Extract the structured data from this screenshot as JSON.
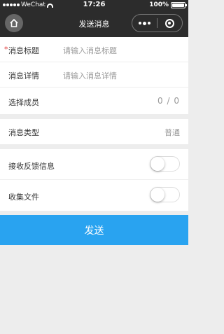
{
  "status_bar": {
    "carrier": "WeChat",
    "time": "17:26",
    "battery": "100%"
  },
  "nav": {
    "title": "发送消息"
  },
  "form": {
    "title_label": "消息标题",
    "title_placeholder": "请输入消息标题",
    "detail_label": "消息详情",
    "detail_placeholder": "请输入消息详情",
    "members_label": "选择成员",
    "members_count": "0 / 0",
    "type_label": "消息类型",
    "type_value": "普通",
    "feedback_label": "接收反馈信息",
    "collect_label": "收集文件"
  },
  "submit_label": "发送",
  "colors": {
    "accent": "#29a3f0",
    "header": "#2c2c2c"
  }
}
